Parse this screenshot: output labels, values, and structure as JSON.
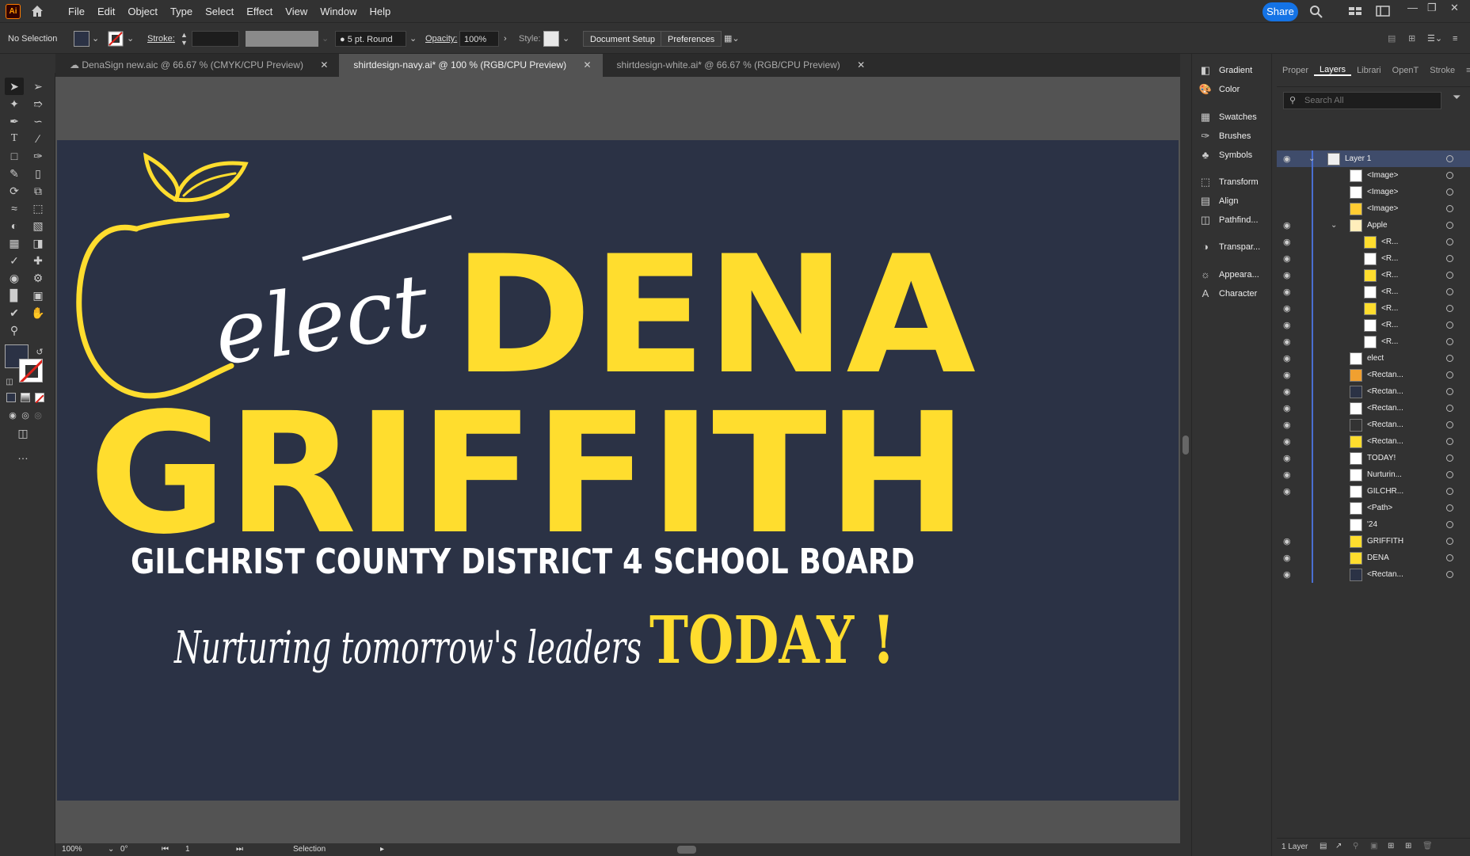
{
  "menubar": {
    "app_logo": "Ai",
    "menus": [
      "File",
      "Edit",
      "Object",
      "Type",
      "Select",
      "Effect",
      "View",
      "Window",
      "Help"
    ],
    "share_label": "Share"
  },
  "control_bar": {
    "selection_label": "No Selection",
    "stroke_label": "Stroke:",
    "brush_label": "5 pt. Round",
    "opacity_label": "Opacity:",
    "opacity_value": "100%",
    "style_label": "Style:",
    "document_setup": "Document Setup",
    "preferences": "Preferences"
  },
  "tabs": [
    {
      "label": "DenaSign new.aic @ 66.67 % (CMYK/CPU Preview)",
      "active": false
    },
    {
      "label": "shirtdesign-navy.ai* @ 100 % (RGB/CPU Preview)",
      "active": true
    },
    {
      "label": "shirtdesign-white.ai* @ 66.67 % (RGB/CPU Preview)",
      "active": false
    }
  ],
  "artwork": {
    "elect": "elect",
    "dena": "DENA",
    "griffith": "GRIFFITH",
    "board": "GILCHRIST COUNTY DISTRICT 4 SCHOOL BOARD",
    "tagline": "Nurturing tomorrow's leaders",
    "today": "TODAY !",
    "colors": {
      "navy": "#2b3245",
      "yellow": "#ffdd2e",
      "white": "#ffffff"
    }
  },
  "status": {
    "zoom": "100%",
    "rotation": "0°",
    "artboard": "1",
    "tool": "Selection"
  },
  "icon_panel": {
    "group1": [
      "Gradient",
      "Color"
    ],
    "group2": [
      "Swatches",
      "Brushes",
      "Symbols"
    ],
    "group3": [
      "Transform",
      "Align",
      "Pathfind..."
    ],
    "group4": [
      "Transpar..."
    ],
    "group5": [
      "Appeara...",
      "Character"
    ]
  },
  "layers_panel": {
    "tabs": [
      "Proper",
      "Layers",
      "Librari",
      "OpenT",
      "Stroke"
    ],
    "search_placeholder": "Search All",
    "rows": [
      {
        "name": "Layer 1",
        "level": 0
      },
      {
        "name": "<Image>",
        "level": 1
      },
      {
        "name": "<Image>",
        "level": 1
      },
      {
        "name": "<Image>",
        "level": 1
      },
      {
        "name": "Apple",
        "level": 1
      },
      {
        "name": "<R...",
        "level": 2
      },
      {
        "name": "<R...",
        "level": 2
      },
      {
        "name": "<R...",
        "level": 2
      },
      {
        "name": "<R...",
        "level": 2
      },
      {
        "name": "<R...",
        "level": 2
      },
      {
        "name": "<R...",
        "level": 2
      },
      {
        "name": "<R...",
        "level": 2
      },
      {
        "name": "elect",
        "level": 1
      },
      {
        "name": "<Rectan...",
        "level": 1
      },
      {
        "name": "<Rectan...",
        "level": 1
      },
      {
        "name": "<Rectan...",
        "level": 1
      },
      {
        "name": "<Rectan...",
        "level": 1
      },
      {
        "name": "<Rectan...",
        "level": 1
      },
      {
        "name": "TODAY!",
        "level": 1
      },
      {
        "name": "Nurturin...",
        "level": 1
      },
      {
        "name": "GILCHR...",
        "level": 1
      },
      {
        "name": "<Path>",
        "level": 1
      },
      {
        "name": "'24",
        "level": 1
      },
      {
        "name": "GRIFFITH",
        "level": 1
      },
      {
        "name": "DENA",
        "level": 1
      },
      {
        "name": "<Rectan...",
        "level": 1
      }
    ],
    "footer_count": "1 Layer"
  }
}
